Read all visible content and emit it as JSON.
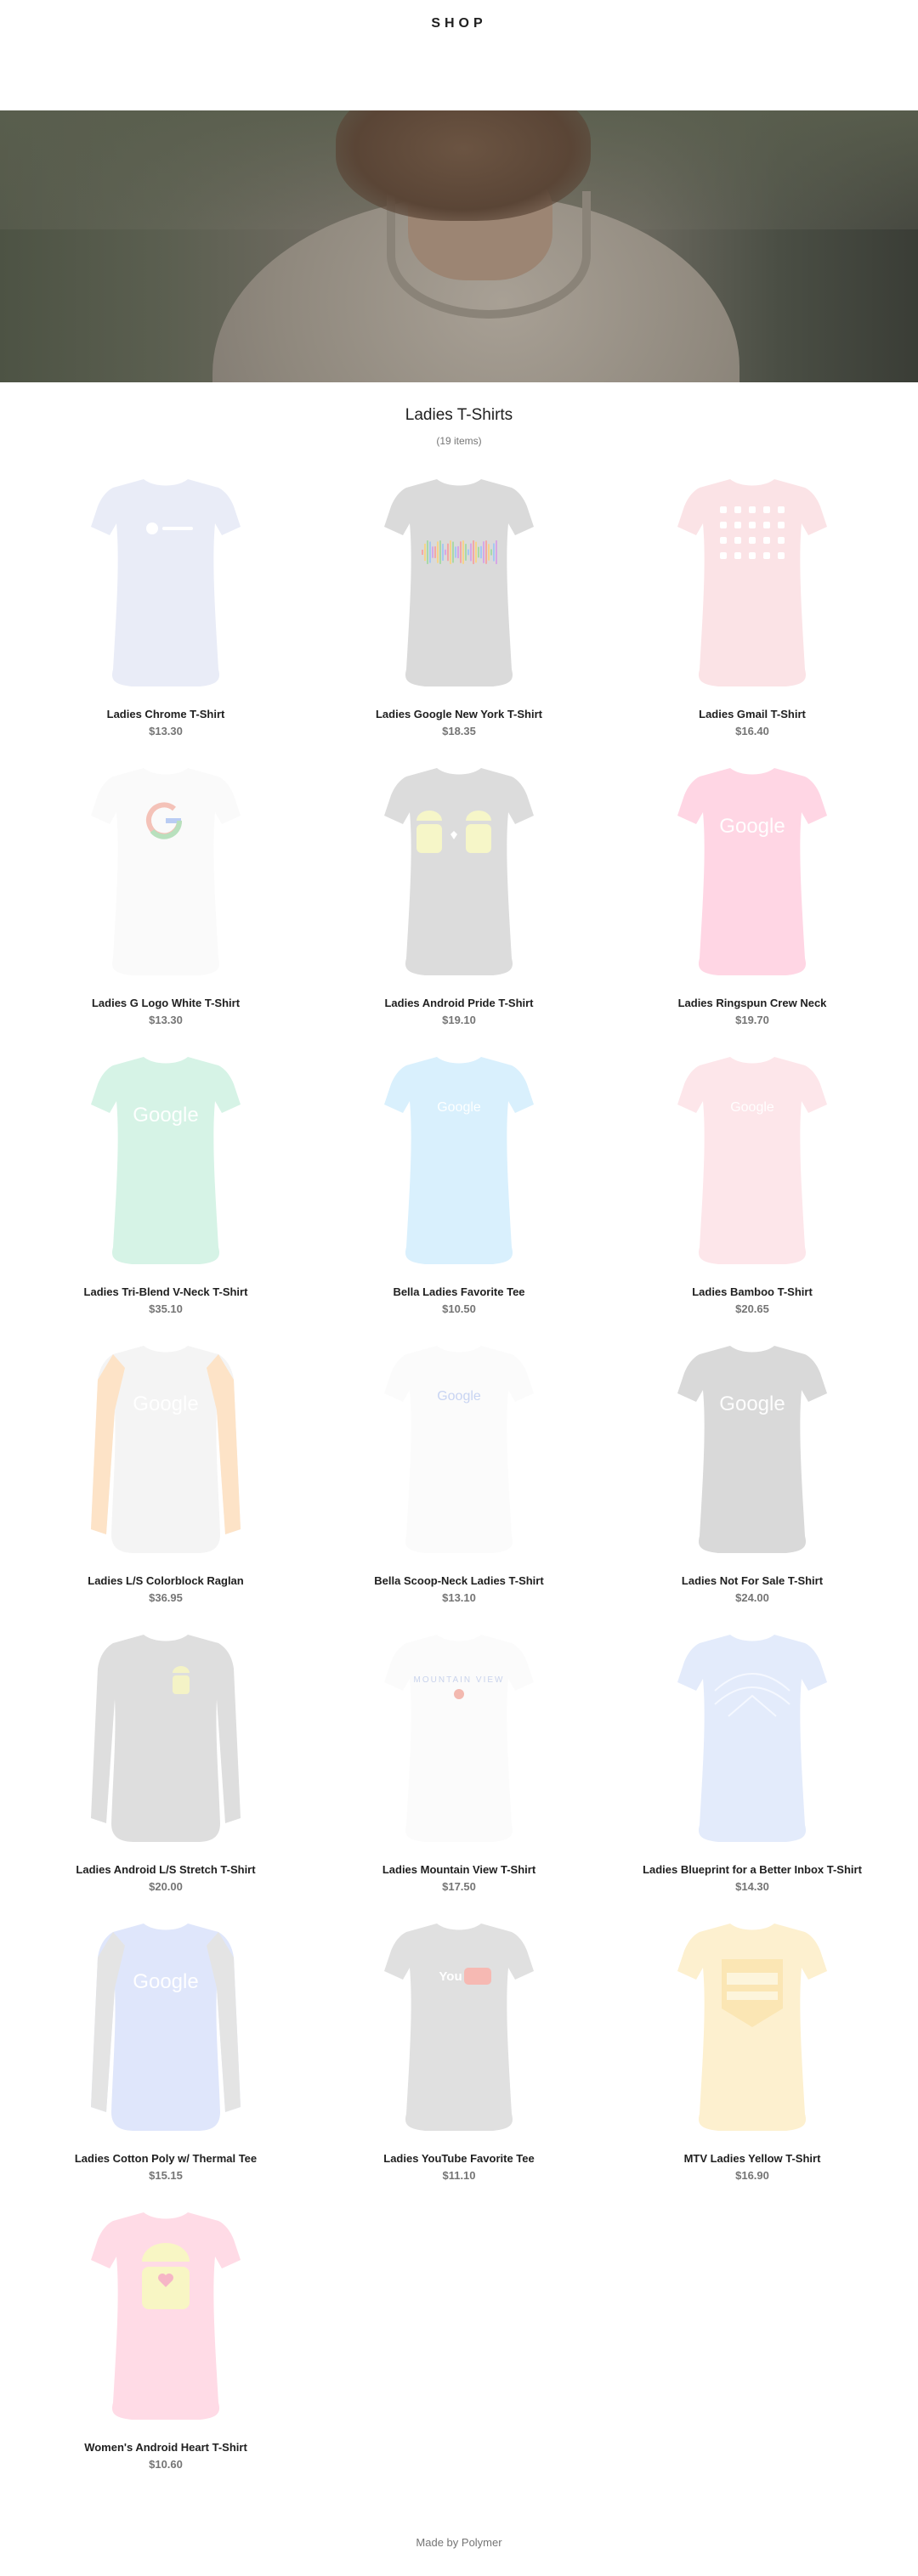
{
  "header": {
    "logo": "SHOP"
  },
  "category": {
    "title": "Ladies T-Shirts",
    "count": "(19 items)"
  },
  "products": [
    {
      "name": "Ladies Chrome T-Shirt",
      "price": "$13.30",
      "color": "#e9ecf7",
      "style": "tee",
      "print": "chrome"
    },
    {
      "name": "Ladies Google New York T-Shirt",
      "price": "$18.35",
      "color": "#dadada",
      "style": "tee",
      "print": "wave"
    },
    {
      "name": "Ladies Gmail T-Shirt",
      "price": "$16.40",
      "color": "#fbe3e6",
      "style": "tee",
      "print": "dots"
    },
    {
      "name": "Ladies G Logo White T-Shirt",
      "price": "$13.30",
      "color": "#fafafa",
      "style": "tee",
      "print": "glogo"
    },
    {
      "name": "Ladies Android Pride T-Shirt",
      "price": "$19.10",
      "color": "#dcdcdc",
      "style": "tee",
      "print": "android-pride"
    },
    {
      "name": "Ladies Ringspun Crew Neck",
      "price": "$19.70",
      "color": "#ffd6e4",
      "style": "tee",
      "print": "google"
    },
    {
      "name": "Ladies Tri-Blend V-Neck T-Shirt",
      "price": "$35.10",
      "color": "#d6f3e6",
      "style": "tee",
      "print": "google"
    },
    {
      "name": "Bella Ladies Favorite Tee",
      "price": "$10.50",
      "color": "#d9f0fd",
      "style": "tee",
      "print": "google-small"
    },
    {
      "name": "Ladies Bamboo T-Shirt",
      "price": "$20.65",
      "color": "#fde6ea",
      "style": "tee",
      "print": "google-small"
    },
    {
      "name": "Ladies L/S Colorblock Raglan",
      "price": "$36.95",
      "color": "#f4f4f4",
      "style": "raglan",
      "print": "google"
    },
    {
      "name": "Bella Scoop-Neck Ladies T-Shirt",
      "price": "$13.10",
      "color": "#fbfbfb",
      "style": "tee",
      "print": "google-color"
    },
    {
      "name": "Ladies Not For Sale T-Shirt",
      "price": "$24.00",
      "color": "#d9d9d9",
      "style": "tee",
      "print": "google"
    },
    {
      "name": "Ladies Android L/S Stretch T-Shirt",
      "price": "$20.00",
      "color": "#dedede",
      "style": "longsleeve",
      "print": "android-small"
    },
    {
      "name": "Ladies Mountain View T-Shirt",
      "price": "$17.50",
      "color": "#fbfbfb",
      "style": "tee",
      "print": "mountain"
    },
    {
      "name": "Ladies Blueprint for a Better Inbox T-Shirt",
      "price": "$14.30",
      "color": "#e3ebfb",
      "style": "tee",
      "print": "blueprint"
    },
    {
      "name": "Ladies Cotton Poly w/ Thermal Tee",
      "price": "$15.15",
      "color": "#dfe6fb",
      "style": "thermal",
      "print": "google"
    },
    {
      "name": "Ladies YouTube Favorite Tee",
      "price": "$11.10",
      "color": "#e0e0e0",
      "style": "tee",
      "print": "youtube"
    },
    {
      "name": "MTV Ladies Yellow T-Shirt",
      "price": "$16.90",
      "color": "#fdf0cf",
      "style": "tee",
      "print": "badge"
    },
    {
      "name": "Women's Android Heart T-Shirt",
      "price": "$10.60",
      "color": "#ffdbe6",
      "style": "tee",
      "print": "android-heart"
    }
  ],
  "footer": {
    "text": "Made by Polymer"
  }
}
